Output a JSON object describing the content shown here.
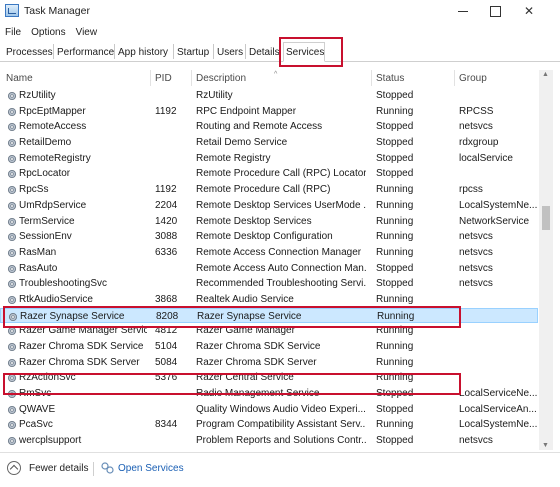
{
  "window": {
    "title": "Task Manager"
  },
  "menu": [
    "File",
    "Options",
    "View"
  ],
  "tabs": [
    "Processes",
    "Performance",
    "App history",
    "Startup",
    "Users",
    "Details",
    "Services"
  ],
  "active_tab": "Services",
  "columns": {
    "name": "Name",
    "pid": "PID",
    "description": "Description",
    "status": "Status",
    "group": "Group"
  },
  "rows": [
    {
      "name": "RzUtility",
      "pid": "",
      "description": "RzUtility",
      "status": "Stopped",
      "group": ""
    },
    {
      "name": "RpcEptMapper",
      "pid": "1192",
      "description": "RPC Endpoint Mapper",
      "status": "Running",
      "group": "RPCSS"
    },
    {
      "name": "RemoteAccess",
      "pid": "",
      "description": "Routing and Remote Access",
      "status": "Stopped",
      "group": "netsvcs"
    },
    {
      "name": "RetailDemo",
      "pid": "",
      "description": "Retail Demo Service",
      "status": "Stopped",
      "group": "rdxgroup"
    },
    {
      "name": "RemoteRegistry",
      "pid": "",
      "description": "Remote Registry",
      "status": "Stopped",
      "group": "localService"
    },
    {
      "name": "RpcLocator",
      "pid": "",
      "description": "Remote Procedure Call (RPC) Locator",
      "status": "Stopped",
      "group": ""
    },
    {
      "name": "RpcSs",
      "pid": "1192",
      "description": "Remote Procedure Call (RPC)",
      "status": "Running",
      "group": "rpcss"
    },
    {
      "name": "UmRdpService",
      "pid": "2204",
      "description": "Remote Desktop Services UserMode ...",
      "status": "Running",
      "group": "LocalSystemNe..."
    },
    {
      "name": "TermService",
      "pid": "1420",
      "description": "Remote Desktop Services",
      "status": "Running",
      "group": "NetworkService"
    },
    {
      "name": "SessionEnv",
      "pid": "3088",
      "description": "Remote Desktop Configuration",
      "status": "Running",
      "group": "netsvcs"
    },
    {
      "name": "RasMan",
      "pid": "6336",
      "description": "Remote Access Connection Manager",
      "status": "Running",
      "group": "netsvcs"
    },
    {
      "name": "RasAuto",
      "pid": "",
      "description": "Remote Access Auto Connection Man...",
      "status": "Stopped",
      "group": "netsvcs"
    },
    {
      "name": "TroubleshootingSvc",
      "pid": "",
      "description": "Recommended Troubleshooting Servi...",
      "status": "Stopped",
      "group": "netsvcs"
    },
    {
      "name": "RtkAudioService",
      "pid": "3868",
      "description": "Realtek Audio Service",
      "status": "Running",
      "group": ""
    },
    {
      "name": "Razer Synapse Service",
      "pid": "8208",
      "description": "Razer Synapse Service",
      "status": "Running",
      "group": ""
    },
    {
      "name": "Razer Game Manager Service",
      "pid": "4812",
      "description": "Razer Game Manager",
      "status": "Running",
      "group": ""
    },
    {
      "name": "Razer Chroma SDK Service",
      "pid": "5104",
      "description": "Razer Chroma SDK Service",
      "status": "Running",
      "group": ""
    },
    {
      "name": "Razer Chroma SDK Server",
      "pid": "5084",
      "description": "Razer Chroma SDK Server",
      "status": "Running",
      "group": ""
    },
    {
      "name": "RzActionSvc",
      "pid": "5376",
      "description": "Razer Central Service",
      "status": "Running",
      "group": ""
    },
    {
      "name": "RmSvc",
      "pid": "",
      "description": "Radio Management Service",
      "status": "Stopped",
      "group": "LocalServiceNe..."
    },
    {
      "name": "QWAVE",
      "pid": "",
      "description": "Quality Windows Audio Video Experi...",
      "status": "Stopped",
      "group": "LocalServiceAn..."
    },
    {
      "name": "PcaSvc",
      "pid": "8344",
      "description": "Program Compatibility Assistant Serv...",
      "status": "Running",
      "group": "LocalSystemNe..."
    },
    {
      "name": "wercplsupport",
      "pid": "",
      "description": "Problem Reports and Solutions Contr...",
      "status": "Stopped",
      "group": "netsvcs"
    }
  ],
  "selected_row": "Razer Synapse Service",
  "footer": {
    "fewer_details": "Fewer details",
    "open_services": "Open Services"
  },
  "colors": {
    "highlight_box": "#c8102e",
    "selection": "#cce8ff",
    "link": "#1a5fb4"
  },
  "icons": {
    "app": "task-manager-icon",
    "service": "service-gear-icon",
    "fewer": "chevron-up-circle-icon",
    "open": "services-icon"
  }
}
